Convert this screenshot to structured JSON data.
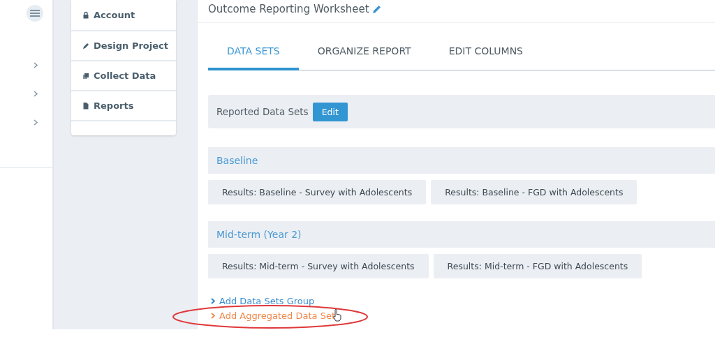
{
  "menu": [
    {
      "label": "Account"
    },
    {
      "label": "Design Project"
    },
    {
      "label": "Collect Data"
    },
    {
      "label": "Reports"
    }
  ],
  "worksheet": {
    "title": "Outcome Reporting Worksheet"
  },
  "tabs": [
    {
      "label": "DATA SETS",
      "selected": true
    },
    {
      "label": "ORGANIZE REPORT",
      "selected": false
    },
    {
      "label": "EDIT COLUMNS",
      "selected": false
    }
  ],
  "reported": {
    "label": "Reported Data Sets",
    "button": "Edit"
  },
  "groups": [
    {
      "name": "Baseline",
      "data_sets": [
        "Results: Baseline - Survey with Adolescents",
        "Results: Baseline - FGD with Adolescents"
      ]
    },
    {
      "name": "Mid-term (Year 2)",
      "data_sets": [
        "Results: Mid-term - Survey with Adolescents",
        "Results: Mid-term - FGD with Adolescents"
      ]
    }
  ],
  "links": [
    {
      "label": "Add Data Sets Group",
      "highlighted": false
    },
    {
      "label": "Add Aggregated Data Set",
      "highlighted": true
    }
  ]
}
